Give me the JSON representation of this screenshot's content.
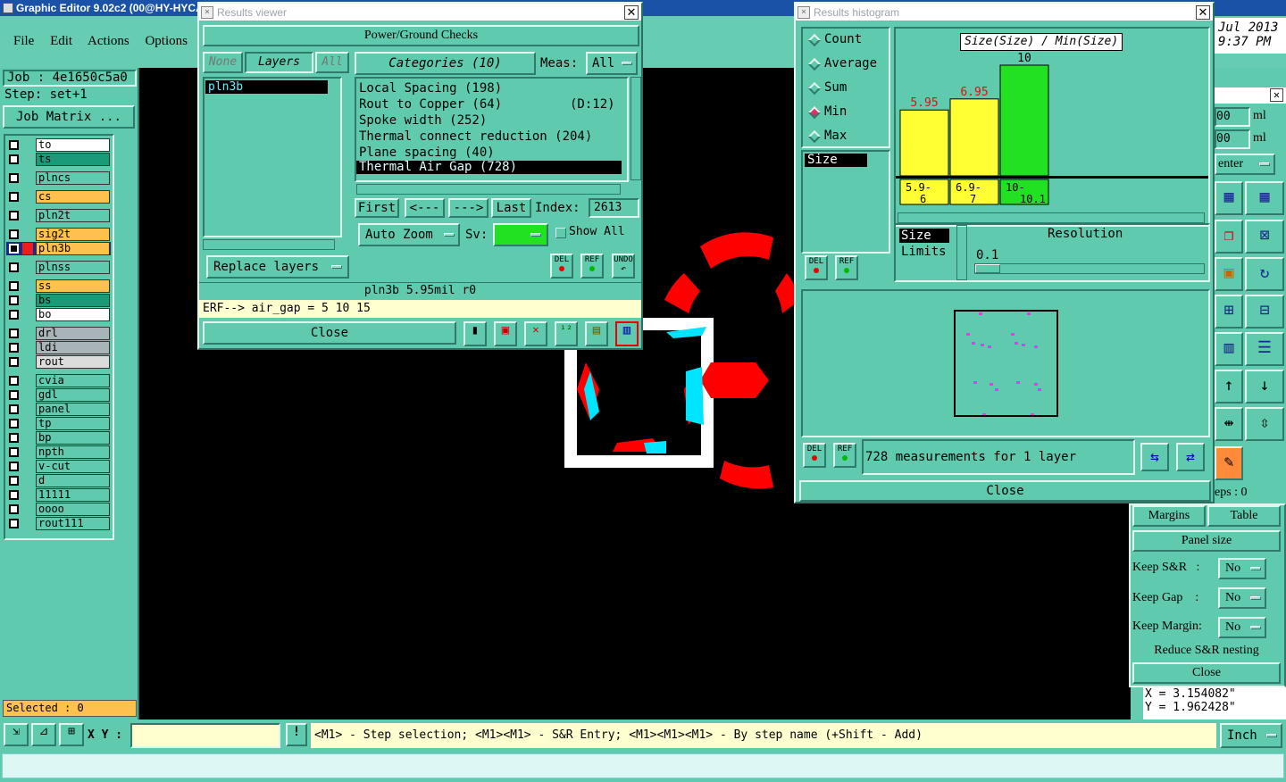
{
  "app": {
    "title": "Graphic Editor 9.02c2 (00@HY-HYCA",
    "menu": [
      "File",
      "Edit",
      "Actions",
      "Options"
    ],
    "clock": {
      "date": "Jul 2013",
      "time": "9:37 PM"
    }
  },
  "job": {
    "job": "Job : 4e1650c5a0",
    "step": "Step: set+1",
    "matrix": "Job Matrix ..."
  },
  "layers": [
    {
      "name": "to",
      "color": "#ffffff"
    },
    {
      "name": "ts",
      "color": "#1a9a78"
    },
    {
      "name": "plncs",
      "color": "#5fcaad"
    },
    {
      "name": "cs",
      "color": "#ffc14d"
    },
    {
      "name": "pln2t",
      "color": "#5fcaad"
    },
    {
      "name": "sig2t",
      "color": "#ffc14d"
    },
    {
      "name": "pln3b",
      "color": "#ffc14d"
    },
    {
      "name": "plnss",
      "color": "#5fcaad"
    },
    {
      "name": "ss",
      "color": "#ffc14d"
    },
    {
      "name": "bs",
      "color": "#1a9a78"
    },
    {
      "name": "bo",
      "color": "#ffffff"
    },
    {
      "name": "drl",
      "color": "#a9b4b8"
    },
    {
      "name": "ldi",
      "color": "#a9b4b8"
    },
    {
      "name": "rout",
      "color": "#dcdcdc"
    },
    {
      "name": "cvia",
      "color": "#5fcaad"
    },
    {
      "name": "gdl",
      "color": "#5fcaad"
    },
    {
      "name": "panel",
      "color": "#5fcaad"
    },
    {
      "name": "tp",
      "color": "#5fcaad"
    },
    {
      "name": "bp",
      "color": "#5fcaad"
    },
    {
      "name": "npth",
      "color": "#5fcaad"
    },
    {
      "name": "v-cut",
      "color": "#5fcaad"
    },
    {
      "name": "d",
      "color": "#5fcaad"
    },
    {
      "name": "11111",
      "color": "#5fcaad"
    },
    {
      "name": "oooo",
      "color": "#5fcaad"
    },
    {
      "name": "rout111",
      "color": "#5fcaad"
    }
  ],
  "selected": "Selected : 0",
  "status": {
    "xy_label": "X Y :",
    "xy_value": "",
    "hint": "<M1> - Step selection; <M1><M1> - S&R Entry; <M1><M1><M1> - By step name (+Shift - Add)",
    "units": "Inch"
  },
  "results": {
    "title": "Results viewer",
    "check": "Power/Ground Checks",
    "none": "None",
    "layers_tab": "Layers",
    "all": "All",
    "layer_list": [
      "pln3b"
    ],
    "categories": "Categories (10)",
    "meas_label": "Meas:",
    "meas_value": "All",
    "category_list": [
      "Local Spacing (198)",
      "Rout to Copper (64)         (D:12)",
      "Spoke width (252)",
      "Thermal connect reduction (204)",
      "Plane spacing (40)",
      "Thermal Air Gap (728)"
    ],
    "nav": {
      "first": "First",
      "prev": "<---",
      "next": "--->",
      "last": "Last",
      "index_label": "Index:",
      "index_value": "2613"
    },
    "auto_zoom": "Auto Zoom",
    "sv": "Sv:",
    "show_all": "Show All",
    "replace": "Replace layers",
    "del": "DEL",
    "ref": "REF",
    "undo": "UNDO",
    "info": "pln3b 5.95mil  r0",
    "erf": "ERF--> air_gap = 5 10 15",
    "close": "Close"
  },
  "histogram": {
    "title": "Results histogram",
    "modes": [
      "Count",
      "Average",
      "Sum",
      "Min",
      "Max"
    ],
    "selected_mode": "Min",
    "field": "Size",
    "chart_title": "Size(Size) / Min(Size)",
    "size_label": "Size",
    "limits": "Limits",
    "resolution_label": "Resolution",
    "resolution_value": "0.1",
    "del": "DEL",
    "ref": "REF",
    "summary": "728 measurements for 1 layer",
    "close": "Close"
  },
  "chart_data": {
    "type": "bar",
    "title": "Size(Size) / Min(Size)",
    "categories": [
      "5.9-6",
      "6.9-7",
      "10-10.1"
    ],
    "values": [
      5.95,
      6.95,
      10
    ],
    "value_labels": [
      "5.95",
      "6.95",
      "10"
    ],
    "colors": [
      "#ffff33",
      "#ffff33",
      "#22e022"
    ],
    "label_colors": [
      "#e01010",
      "#e01010",
      "#000000"
    ]
  },
  "right_panel": {
    "ml1": "ml",
    "ml2": "ml",
    "v1": "00",
    "v2": "00",
    "center": "enter",
    "steps": "eps : 0",
    "margins": "Margins",
    "table": "Table",
    "panel_size": "Panel size",
    "keep_sr": "Keep S&R   :",
    "keep_gap": "Keep Gap    :",
    "keep_margin": "Keep Margin:",
    "no": "No",
    "reduce": "Reduce S&R nesting",
    "close": "Close",
    "x": "X = 3.154082\"",
    "y": "Y = 1.962428\""
  }
}
